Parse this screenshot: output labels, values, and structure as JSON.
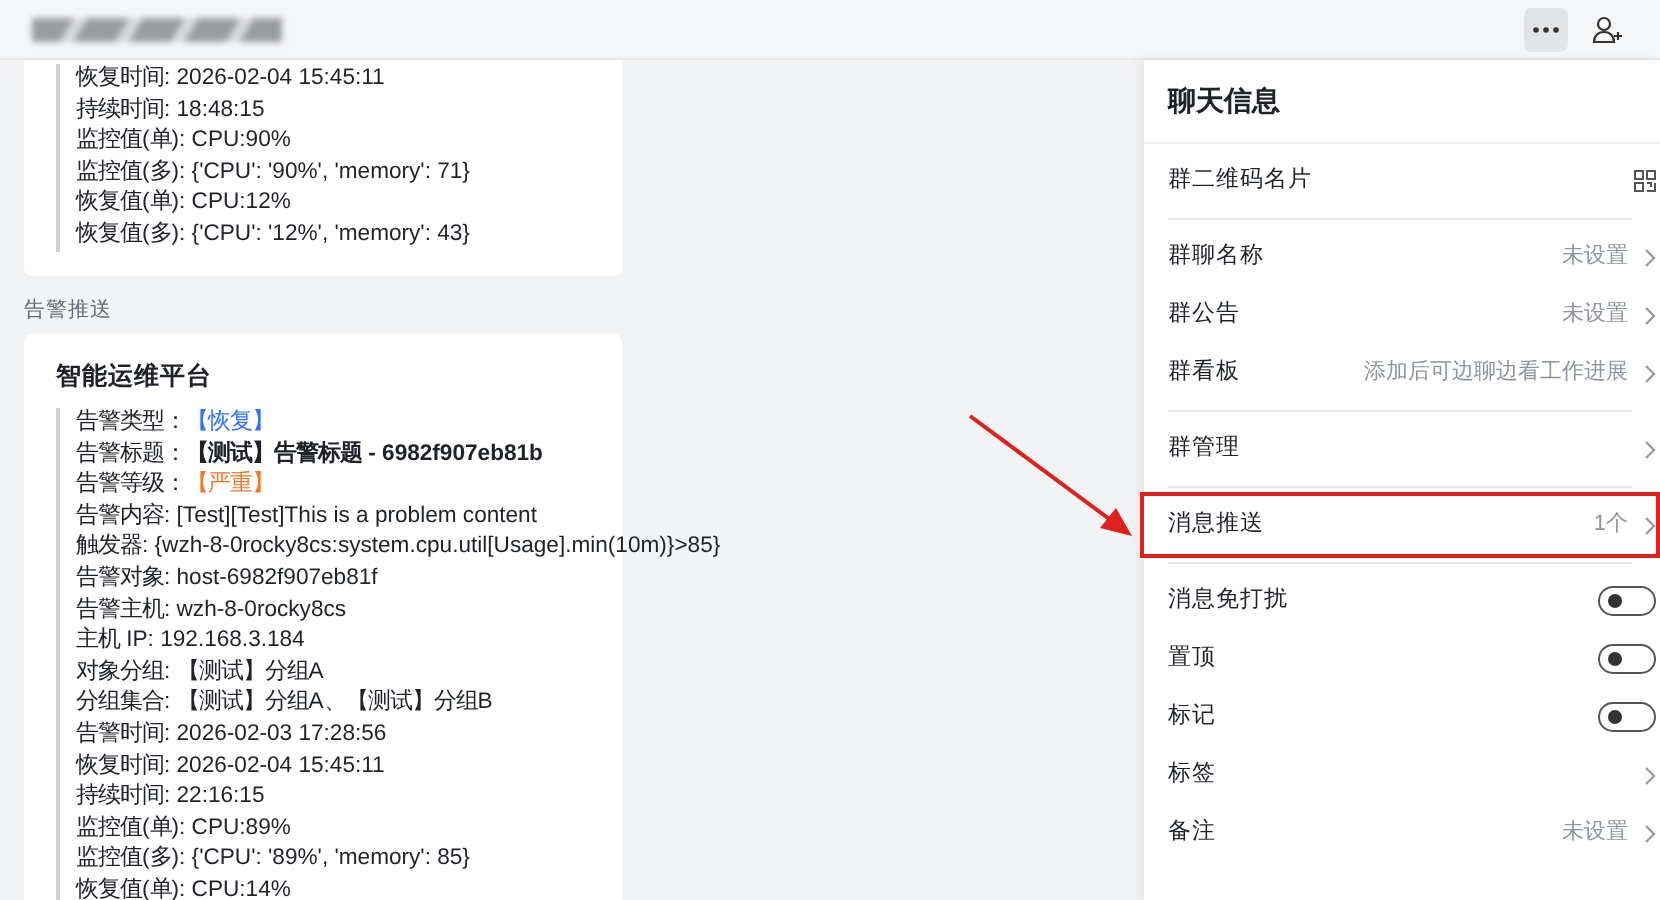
{
  "header": {
    "has_title_redacted": true
  },
  "messages": [
    {
      "lines": [
        {
          "kind": "plain",
          "text": "恢复时间: 2026-02-04 15:45:11"
        },
        {
          "kind": "plain",
          "text": "持续时间:  18:48:15"
        },
        {
          "kind": "plain",
          "text": "监控值(单): CPU:90%"
        },
        {
          "kind": "plain",
          "text": "监控值(多): {'CPU': '90%', 'memory': 71}"
        },
        {
          "kind": "plain",
          "text": "恢复值(单): CPU:12%"
        },
        {
          "kind": "plain",
          "text": "恢复值(多): {'CPU': '12%', 'memory': 43}"
        }
      ]
    },
    {
      "sender_label": "告警推送",
      "title": "智能运维平台",
      "lines": [
        {
          "kind": "info",
          "label": "告警类型：",
          "value": "【恢复】"
        },
        {
          "kind": "bold",
          "label": "告警标题：",
          "value": "【测试】告警标题 - 6982f907eb81b"
        },
        {
          "kind": "warning",
          "label": "告警等级：",
          "value": "【严重】"
        },
        {
          "kind": "plain",
          "text": "告警内容: [Test][Test]This is a problem content"
        },
        {
          "kind": "plain",
          "text": "触发器: {wzh-8-0rocky8cs:system.cpu.util[Usage].min(10m)}>85}"
        },
        {
          "kind": "plain",
          "text": "告警对象: host-6982f907eb81f"
        },
        {
          "kind": "plain",
          "text": "告警主机: wzh-8-0rocky8cs"
        },
        {
          "kind": "plain",
          "text": "主机  IP: 192.168.3.184"
        },
        {
          "kind": "plain",
          "text": "对象分组: 【测试】分组A"
        },
        {
          "kind": "plain",
          "text": "分组集合: 【测试】分组A、【测试】分组B"
        },
        {
          "kind": "plain",
          "text": "告警时间: 2026-02-03 17:28:56"
        },
        {
          "kind": "plain",
          "text": "恢复时间: 2026-02-04 15:45:11"
        },
        {
          "kind": "plain",
          "text": "持续时间:  22:16:15"
        },
        {
          "kind": "plain",
          "text": "监控值(单): CPU:89%"
        },
        {
          "kind": "plain",
          "text": "监控值(多): {'CPU': '89%', 'memory': 85}"
        },
        {
          "kind": "plain",
          "text": "恢复值(单): CPU:14%"
        }
      ]
    }
  ],
  "panel": {
    "title": "聊天信息",
    "sections": [
      [
        {
          "kind": "qr",
          "label": "群二维码名片"
        }
      ],
      [
        {
          "kind": "link",
          "label": "群聊名称",
          "value": "未设置"
        },
        {
          "kind": "link",
          "label": "群公告",
          "value": "未设置"
        },
        {
          "kind": "link",
          "label": "群看板",
          "value": "添加后可边聊边看工作进展"
        }
      ],
      [
        {
          "kind": "link",
          "label": "群管理"
        }
      ],
      [
        {
          "kind": "link",
          "label": "消息推送",
          "value": "1个",
          "highlighted": true
        }
      ],
      [
        {
          "kind": "toggle",
          "label": "消息免打扰",
          "on": false
        },
        {
          "kind": "toggle",
          "label": "置顶",
          "on": false
        },
        {
          "kind": "toggle",
          "label": "标记",
          "on": false
        },
        {
          "kind": "link",
          "label": "标签"
        },
        {
          "kind": "link",
          "label": "备注",
          "value": "未设置"
        }
      ]
    ]
  }
}
